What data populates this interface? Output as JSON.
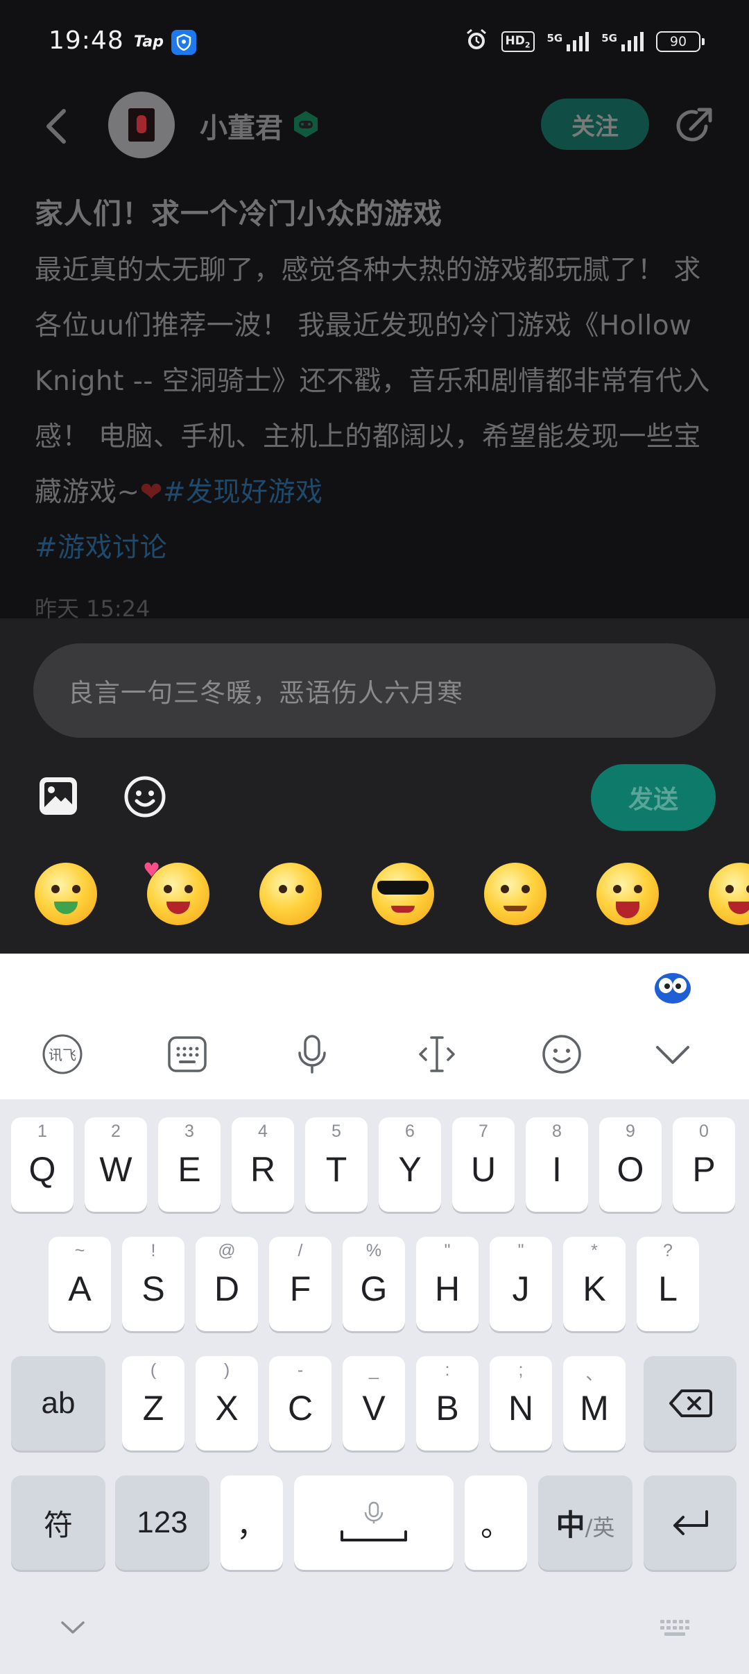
{
  "status_bar": {
    "time": "19:48",
    "app_logo": "Tap",
    "hd_label": "HD",
    "hd_sub": "2",
    "signal1_label": "5G",
    "signal2_label": "5G",
    "battery": "90",
    "icons": [
      "tap-icon",
      "shield-icon",
      "alarm-icon",
      "hd-icon",
      "signal-icon",
      "battery-icon"
    ]
  },
  "header": {
    "username": "小董君",
    "follow_label": "关注"
  },
  "post": {
    "title": "家人们！求一个冷门小众的游戏",
    "body": "最近真的太无聊了，感觉各种大热的游戏都玩腻了！ 求各位uu们推荐一波！ 我最近发现的冷门游戏《Hollow Knight -- 空洞骑士》还不戳，音乐和剧情都非常有代入感！ 电脑、手机、主机上的都阔以，希望能发现一些宝藏游戏~",
    "heart": "❤",
    "tags": [
      "#发现好游戏",
      "#游戏讨论"
    ],
    "time": "昨天 15:24"
  },
  "composer": {
    "placeholder": "良言一句三冬暖，恶语伤人六月寒",
    "send_label": "发送"
  },
  "keyboard": {
    "row1": [
      {
        "key": "Q",
        "sub": "1"
      },
      {
        "key": "W",
        "sub": "2"
      },
      {
        "key": "E",
        "sub": "3"
      },
      {
        "key": "R",
        "sub": "4"
      },
      {
        "key": "T",
        "sub": "5"
      },
      {
        "key": "Y",
        "sub": "6"
      },
      {
        "key": "U",
        "sub": "7"
      },
      {
        "key": "I",
        "sub": "8"
      },
      {
        "key": "O",
        "sub": "9"
      },
      {
        "key": "P",
        "sub": "0"
      }
    ],
    "row2": [
      {
        "key": "A",
        "sub": "~"
      },
      {
        "key": "S",
        "sub": "!"
      },
      {
        "key": "D",
        "sub": "@"
      },
      {
        "key": "F",
        "sub": "/"
      },
      {
        "key": "G",
        "sub": "%"
      },
      {
        "key": "H",
        "sub": "\""
      },
      {
        "key": "J",
        "sub": "\""
      },
      {
        "key": "K",
        "sub": "*"
      },
      {
        "key": "L",
        "sub": "?"
      }
    ],
    "row3": [
      {
        "key": "Z",
        "sub": "("
      },
      {
        "key": "X",
        "sub": ")"
      },
      {
        "key": "C",
        "sub": "-"
      },
      {
        "key": "V",
        "sub": "_"
      },
      {
        "key": "B",
        "sub": ":"
      },
      {
        "key": "N",
        "sub": ";"
      },
      {
        "key": "M",
        "sub": "、"
      }
    ],
    "ab_label": "ab",
    "symbol_label": "符",
    "number_label": "123",
    "comma_label": "，",
    "period_label": "。",
    "lang_cn": "中",
    "lang_en": "/英"
  }
}
